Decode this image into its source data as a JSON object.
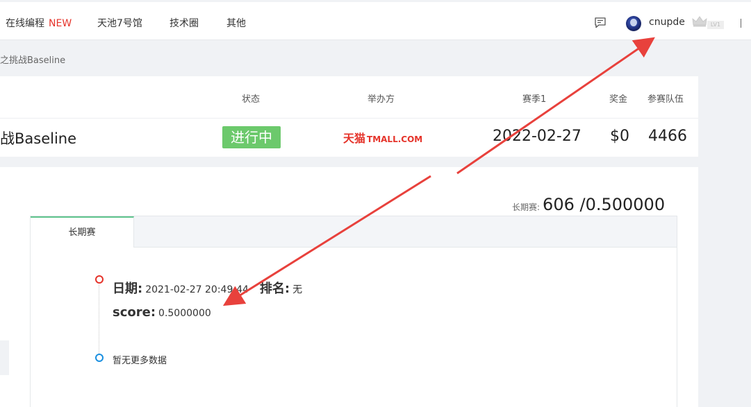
{
  "nav": {
    "items": [
      {
        "label": "在线编程",
        "badge": "NEW"
      },
      {
        "label": "天池7号馆"
      },
      {
        "label": "技术圈"
      },
      {
        "label": "其他"
      }
    ],
    "username": "cnupde",
    "level": "LV1",
    "message_icon": "message-icon",
    "crown_icon": "crown-icon"
  },
  "breadcrumb": "之挑战Baseline",
  "competition": {
    "headers": {
      "status": "状态",
      "organizer": "举办方",
      "season": "赛季1",
      "prize": "奖金",
      "teams": "参赛队伍"
    },
    "name": "战Baseline",
    "status": "进行中",
    "organizer_logo": {
      "cn": "天猫",
      "en": "TMALL.COM"
    },
    "season_date": "2022-02-27",
    "prize": "$0",
    "teams": "4466"
  },
  "long_term": {
    "label": "长期赛:",
    "value": "606 /0.500000",
    "tab": "长期赛"
  },
  "submission": {
    "date_label": "日期:",
    "date_value": "2021-02-27 20:49:44",
    "rank_label": "排名:",
    "rank_value": "无",
    "score_label": "score:",
    "score_value": "0.5000000",
    "no_more": "暂无更多数据"
  },
  "colors": {
    "accent_green": "#5ec48c",
    "status_green": "#6cc96c",
    "brand_red": "#e5332a",
    "arrow_red": "#e8413c",
    "timeline_blue": "#1a8fe0"
  }
}
